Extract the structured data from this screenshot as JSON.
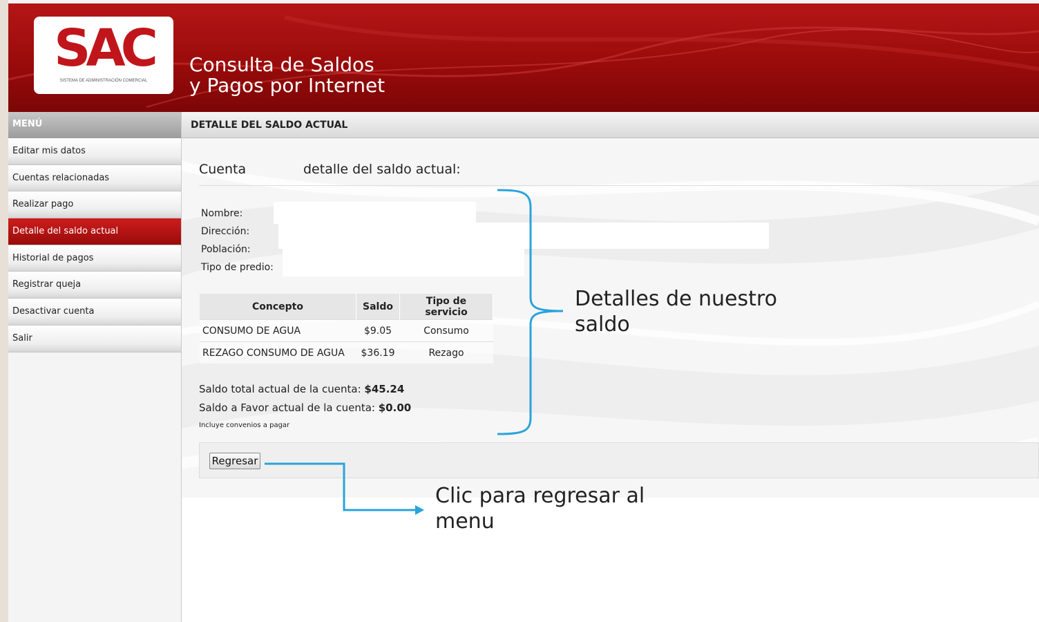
{
  "app": {
    "logo_text": "SAC",
    "logo_subtitle": "SISTEMA DE ADMINISTRACIÓN COMERCIAL",
    "title_line1": "Consulta de Saldos",
    "title_line2": "y Pagos por Internet",
    "brand_color": "#9a0b0b"
  },
  "sidebar": {
    "header": "MENÚ",
    "items": [
      {
        "label": "Editar mis datos"
      },
      {
        "label": "Cuentas relacionadas"
      },
      {
        "label": "Realizar pago"
      },
      {
        "label": "Detalle del saldo actual",
        "active": true
      },
      {
        "label": "Historial de pagos"
      },
      {
        "label": "Registrar queja"
      },
      {
        "label": "Desactivar cuenta"
      },
      {
        "label": "Salir"
      }
    ]
  },
  "main": {
    "section_title": "DETALLE DEL SALDO ACTUAL",
    "account_label": "Cuenta",
    "account_detail_label": "detalle del saldo actual:",
    "fields": {
      "nombre": "Nombre:",
      "direccion": "Dirección:",
      "poblacion": "Población:",
      "tipo_predio": "Tipo de predio:"
    },
    "table": {
      "headers": [
        "Concepto",
        "Saldo",
        "Tipo de servicio"
      ],
      "rows": [
        [
          "CONSUMO DE AGUA",
          "$9.05",
          "Consumo"
        ],
        [
          "REZAGO CONSUMO DE AGUA",
          "$36.19",
          "Rezago"
        ]
      ]
    },
    "total_label": "Saldo total actual de la cuenta:",
    "total_value": "$45.24",
    "favor_label": "Saldo a Favor actual de la cuenta:",
    "favor_value": "$0.00",
    "note": "Incluye convenios a pagar",
    "back_button": "Regresar"
  },
  "annotations": {
    "details_line1": "Detalles de nuestro",
    "details_line2": "saldo",
    "back_line1": "Clic para regresar al",
    "back_line2": "menu",
    "color": "#2aa3dc"
  }
}
